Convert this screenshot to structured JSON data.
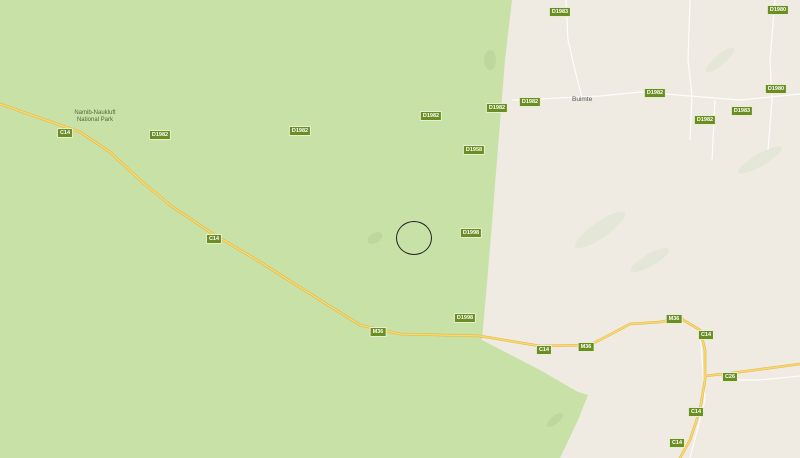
{
  "map": {
    "park_label_line1": "Namib-Naukluft",
    "park_label_line2": "National Park",
    "place_buimte": "Buimte",
    "colors": {
      "park_green": "#c8e1a7",
      "land": "#efebe2",
      "road_yellow": "#f7d26a",
      "shield_bg": "#6b8e23"
    },
    "shields": {
      "c14_a": "C14",
      "d1982_a": "D1982",
      "d1982_b": "D1982",
      "d1982_c": "D1982",
      "d1982_d": "D1982",
      "d1982_e": "D1982",
      "d1982_f": "D1982",
      "d1982_g": "D1982",
      "d1982_h": "D1982",
      "d1958": "D1958",
      "d1998_a": "D1998",
      "d1998_b": "D1998",
      "c14_b": "C14",
      "m36_a": "M36",
      "c14_c": "C14",
      "m36_b": "M36",
      "m36_c": "M36",
      "c14_d": "C14",
      "c26": "C26",
      "c14_e": "C14",
      "c14_f": "C14",
      "d1983_a": "D1983",
      "d1980_a": "D1980",
      "d1980_b": "D1980",
      "d1983_b": "D1983"
    },
    "marker_icon": "circle-marker"
  }
}
